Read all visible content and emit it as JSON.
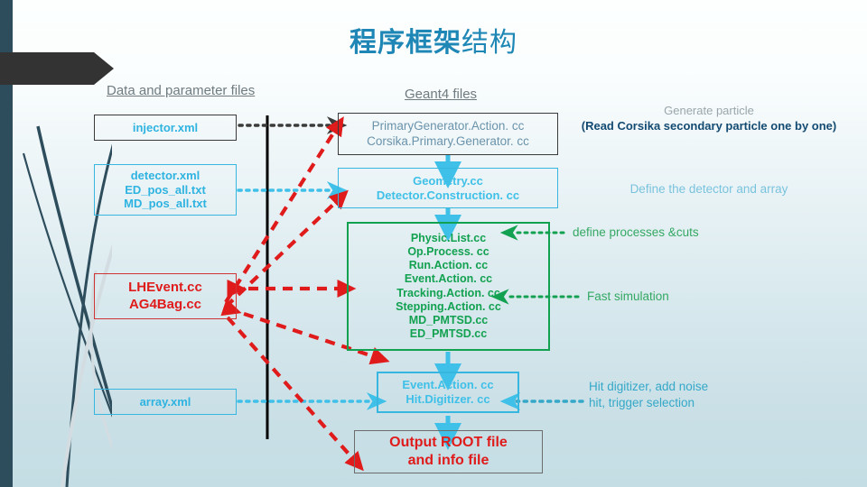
{
  "title": {
    "bold": "程序框架",
    "rest": "结构"
  },
  "columns": {
    "left_head": "Data and parameter files",
    "mid_head": "Geant4 files"
  },
  "boxes": {
    "injector": {
      "lines": [
        "injector.xml"
      ]
    },
    "detector": {
      "lines": [
        "detector.xml",
        "ED_pos_all.txt",
        "MD_pos_all.txt"
      ]
    },
    "lhevent": {
      "lines": [
        "LHEvent.cc",
        "AG4Bag.cc"
      ]
    },
    "array": {
      "lines": [
        "array.xml"
      ]
    },
    "primary": {
      "lines": [
        "PrimaryGenerator.Action. cc",
        "Corsika.Primary.Generator. cc"
      ]
    },
    "geometry": {
      "lines": [
        "Geometry.cc",
        "Detector.Construction. cc"
      ]
    },
    "physics": {
      "lines": [
        "Physic.List.cc",
        "Op.Process. cc",
        "Run.Action. cc",
        "Event.Action. cc",
        "Tracking.Action. cc",
        "Stepping.Action. cc",
        "MD_PMTSD.cc",
        "ED_PMTSD.cc"
      ]
    },
    "digitizer": {
      "lines": [
        "Event.Action. cc",
        "Hit.Digitizer. cc"
      ]
    },
    "output": {
      "lines": [
        "Output ROOT file",
        "and info file"
      ]
    }
  },
  "annotations": {
    "generate_plain": "Generate particle",
    "generate_bold_open": "(",
    "generate_bold": "Read Corsika secondary particle one by one",
    "generate_bold_close": ")",
    "define_detector": "Define the detector and array",
    "define_processes": "define processes &cuts",
    "fast_sim": "Fast simulation",
    "hit_digit_l1": "Hit digitizer, add noise",
    "hit_digit_l2": "hit, trigger selection"
  },
  "colors": {
    "accent_cyan": "#2fb3e0",
    "green": "#12a150",
    "red": "#e01b1b",
    "navy": "#134a72",
    "leftbar": "#2e4d5c",
    "pennant": "#333333",
    "heading_gray": "#6f7b80"
  }
}
